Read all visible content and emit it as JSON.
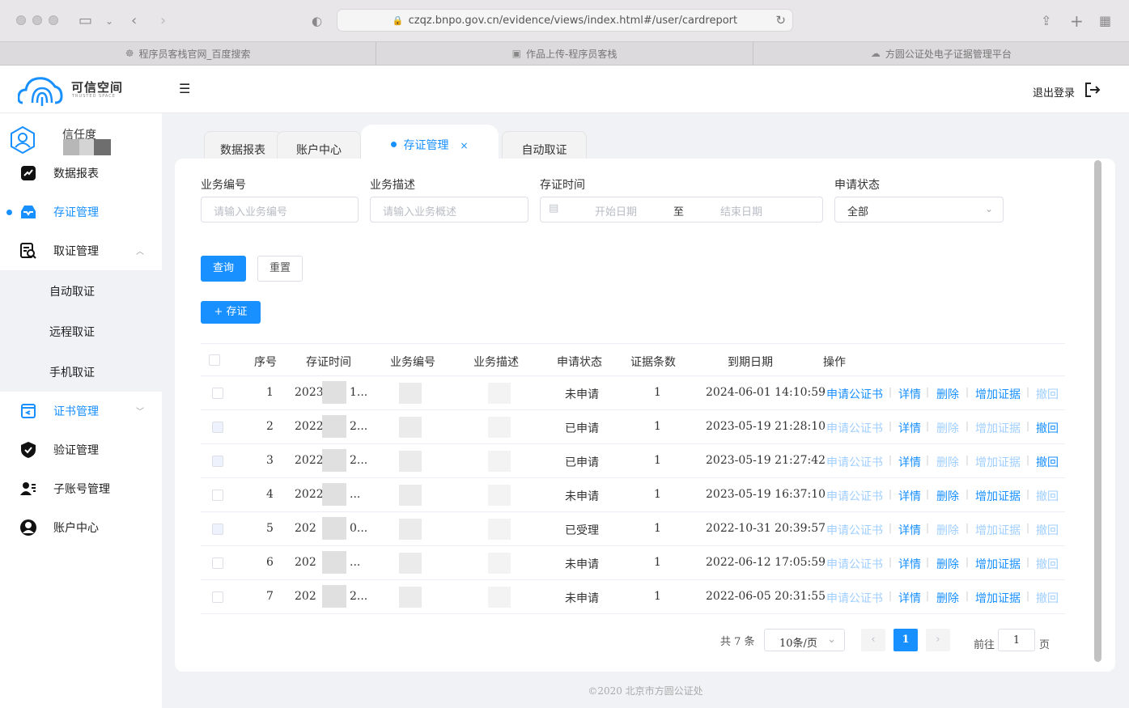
{
  "browser": {
    "url": "czqz.bnpo.gov.cn/evidence/views/index.html#/user/cardreport",
    "tabs": [
      {
        "label": "程序员客栈官网_百度搜索"
      },
      {
        "label": "作品上传-程序员客栈"
      },
      {
        "label": "方圆公证处电子证据管理平台"
      }
    ]
  },
  "header": {
    "logo_text": "可信空间",
    "logo_sub": "TRUSTED SPACE",
    "logout_label": "退出登录"
  },
  "sidebar": {
    "user_label": "信任度",
    "items": [
      {
        "label": "数据报表"
      },
      {
        "label": "存证管理"
      },
      {
        "label": "取证管理"
      },
      {
        "label": "证书管理"
      },
      {
        "label": "验证管理"
      },
      {
        "label": "子账号管理"
      },
      {
        "label": "账户中心"
      }
    ],
    "sub_items": [
      {
        "label": "自动取证"
      },
      {
        "label": "远程取证"
      },
      {
        "label": "手机取证"
      }
    ]
  },
  "page_tabs": [
    {
      "label": "数据报表"
    },
    {
      "label": "账户中心"
    },
    {
      "label": "存证管理",
      "close": "×"
    },
    {
      "label": "自动取证"
    }
  ],
  "filters": {
    "biz_no_label": "业务编号",
    "biz_no_placeholder": "请输入业务编号",
    "biz_desc_label": "业务描述",
    "biz_desc_placeholder": "请输入业务概述",
    "time_label": "存证时间",
    "start_placeholder": "开始日期",
    "range_sep": "至",
    "end_placeholder": "结束日期",
    "status_label": "申请状态",
    "status_value": "全部"
  },
  "buttons": {
    "query": "查询",
    "reset": "重置",
    "add": "+ 存证"
  },
  "table": {
    "headers": [
      "序号",
      "存证时间",
      "业务编号",
      "业务描述",
      "申请状态",
      "证据条数",
      "到期日期",
      "操作"
    ],
    "rows": [
      {
        "no": "1",
        "time": "2023",
        "time_tail": "1...",
        "status": "未申请",
        "count": "1",
        "expire": "2024-06-01 14:10:59",
        "ops": [
          true,
          true,
          true,
          true,
          false
        ]
      },
      {
        "no": "2",
        "time": "2022",
        "time_tail": "2...",
        "status": "已申请",
        "count": "1",
        "expire": "2023-05-19 21:28:10",
        "ops": [
          false,
          true,
          false,
          false,
          true
        ]
      },
      {
        "no": "3",
        "time": "2022",
        "time_tail": "2...",
        "status": "已申请",
        "count": "1",
        "expire": "2023-05-19 21:27:42",
        "ops": [
          false,
          true,
          false,
          false,
          true
        ]
      },
      {
        "no": "4",
        "time": "2022",
        "time_tail": "...",
        "status": "未申请",
        "count": "1",
        "expire": "2023-05-19 16:37:10",
        "ops": [
          false,
          true,
          true,
          true,
          false
        ]
      },
      {
        "no": "5",
        "time": "202",
        "time_tail": "0...",
        "status": "已受理",
        "count": "1",
        "expire": "2022-10-31 20:39:57",
        "ops": [
          false,
          true,
          false,
          false,
          false
        ]
      },
      {
        "no": "6",
        "time": "202",
        "time_tail": "...",
        "status": "未申请",
        "count": "1",
        "expire": "2022-06-12 17:05:59",
        "ops": [
          false,
          true,
          true,
          true,
          false
        ]
      },
      {
        "no": "7",
        "time": "202",
        "time_tail": "2...",
        "status": "未申请",
        "count": "1",
        "expire": "2022-06-05 20:31:55",
        "ops": [
          false,
          true,
          true,
          true,
          false
        ]
      }
    ],
    "op_labels": [
      "申请公证书",
      "详情",
      "删除",
      "增加证据",
      "撤回"
    ]
  },
  "pagination": {
    "total": "共 7 条",
    "page_size": "10条/页",
    "current": "1",
    "goto_label": "前往",
    "goto_value": "1",
    "page_label": "页"
  },
  "footer": "©2020 北京市方圆公证处",
  "colors": {
    "primary": "#1890ff",
    "disabled_link": "#a0cfff"
  }
}
